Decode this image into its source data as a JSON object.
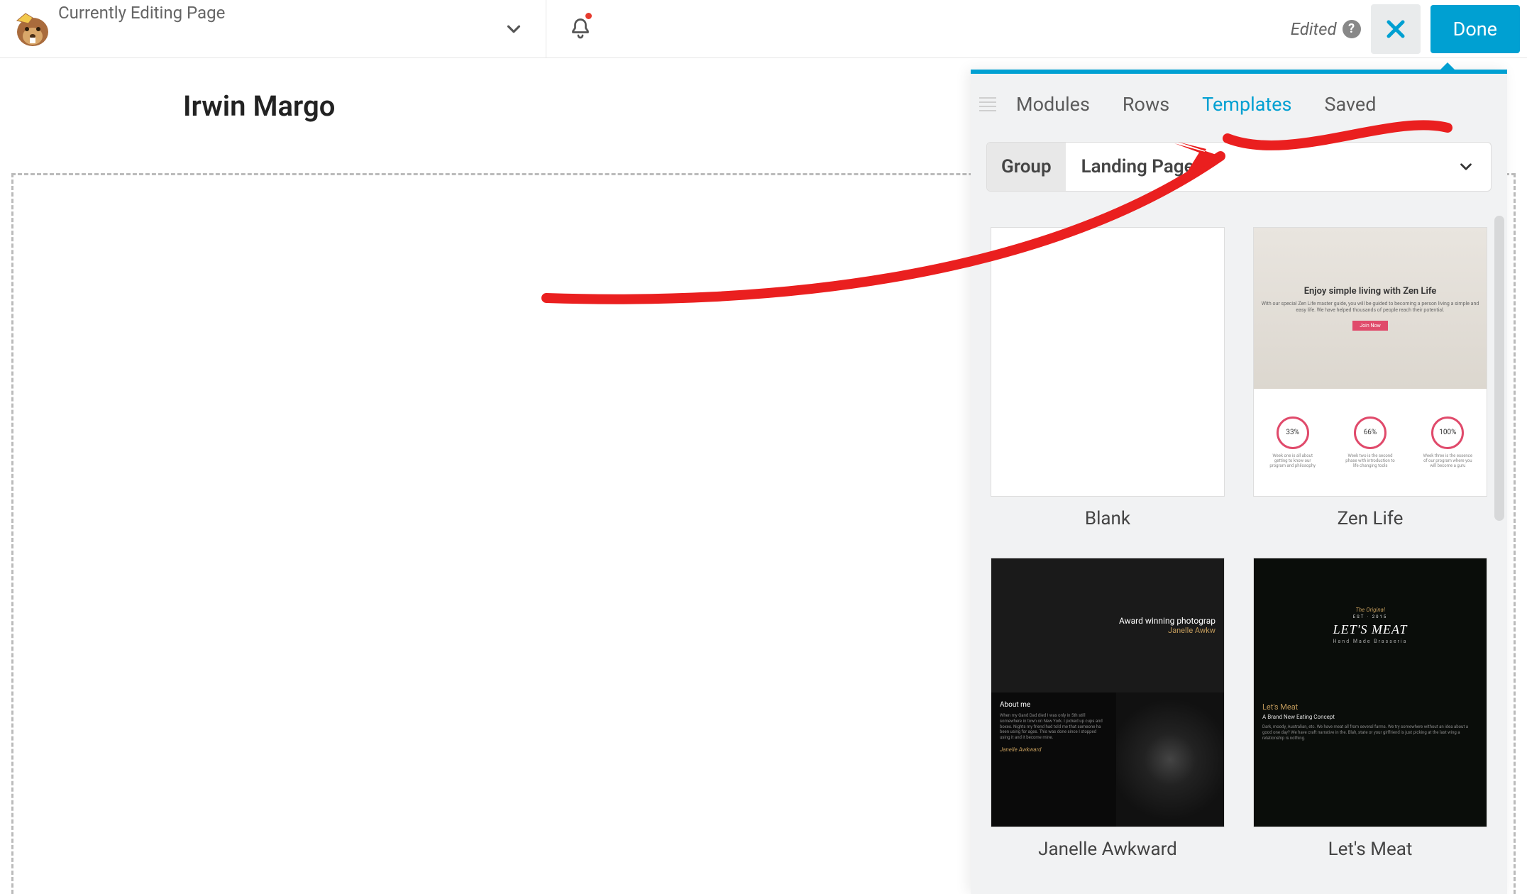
{
  "topbar": {
    "editing_label": "Currently Editing Page",
    "edited_label": "Edited",
    "done_label": "Done"
  },
  "page": {
    "title": "Irwin Margo"
  },
  "panel": {
    "tabs": [
      "Modules",
      "Rows",
      "Templates",
      "Saved"
    ],
    "active_tab": "Templates",
    "group_label": "Group",
    "group_value": "Landing Pages",
    "templates": [
      {
        "name": "Blank"
      },
      {
        "name": "Zen Life"
      },
      {
        "name": "Janelle Awkward"
      },
      {
        "name": "Let's Meat"
      }
    ],
    "zen": {
      "headline": "Enjoy simple living with Zen Life",
      "sub": "With our special Zen Life master guide, you will be guided to becoming a person living a simple and easy life. We have helped thousands of people reach their potential.",
      "btn": "Join Now",
      "c1": "33%",
      "c2": "66%",
      "c3": "100%",
      "t1": "Week one is all about getting to know our program and philosophy",
      "t2": "Week two is the second phase with introduction to life changing tools",
      "t3": "Week three is the essence of our program where you will become a guru"
    },
    "jan": {
      "line1": "Award winning photograp",
      "line2": "Janelle Awkw",
      "about_title": "About me",
      "about_text": "When my Gand Dad died I was only in 5th still somewhere in town on New York. I picked up cups and boxes. Nights my friend had told me that someone ha been using for ages. This was done since I stopped using it and it become mine.",
      "sig": "Janelle Awkward"
    },
    "meat": {
      "orig": "The Original",
      "est": "EST · 2015",
      "logo": "LET'S MEAT",
      "logo_sub": "Hand Made Brasseria",
      "head": "Let's Meat",
      "sub": "A Brand New Eating Concept",
      "text": "Dark, moody, Australian, etc. We have meat all from several farms. We try somewhere without an idea about a good one day? We have craft narrative in the. Blah, state or your girlfriend is just picking at the last wing a relationship is nothing."
    }
  }
}
